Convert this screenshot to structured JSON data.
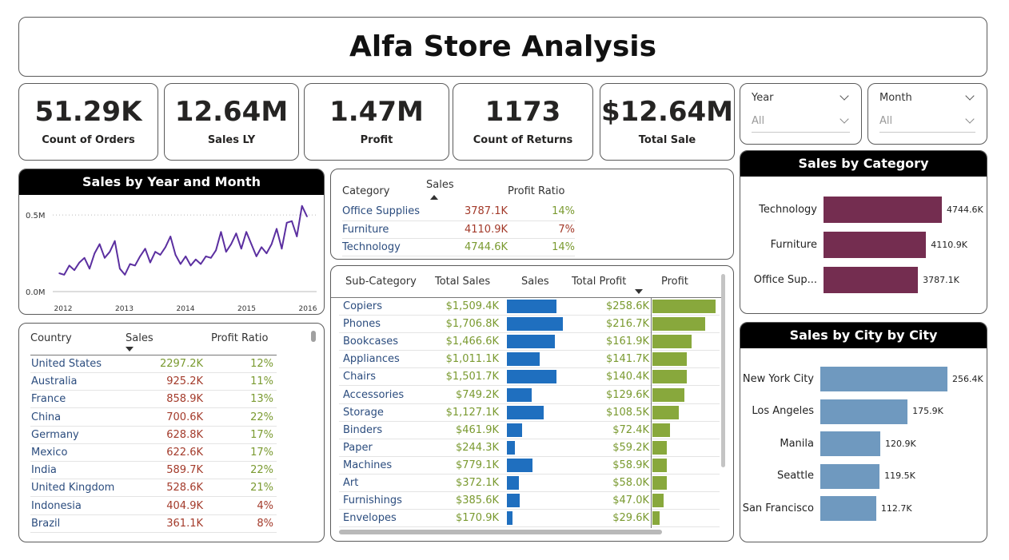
{
  "title": "Alfa Store Analysis",
  "kpis": [
    {
      "value": "51.29K",
      "label": "Count of Orders"
    },
    {
      "value": "12.64M",
      "label": "Sales LY"
    },
    {
      "value": "1.47M",
      "label": "Profit"
    },
    {
      "value": "1173",
      "label": "Count of Returns"
    },
    {
      "value": "$12.64M",
      "label": "Total Sale"
    }
  ],
  "slicers": {
    "year": {
      "label": "Year",
      "value": "All"
    },
    "month": {
      "label": "Month",
      "value": "All"
    }
  },
  "line_chart": {
    "title": "Sales by Year and Month",
    "y_ticks": [
      "0.5M",
      "0.0M"
    ],
    "x_ticks": [
      "2012",
      "2013",
      "2014",
      "2015",
      "2016"
    ],
    "color": "#5b2fa0"
  },
  "category_table": {
    "headers": [
      "Category",
      "Sales",
      "Profit Ratio"
    ],
    "rows": [
      {
        "name": "Office Supplies",
        "sales": "3787.1K",
        "ratio": "14%"
      },
      {
        "name": "Furniture",
        "sales": "4110.9K",
        "ratio": "7%"
      },
      {
        "name": "Technology",
        "sales": "4744.6K",
        "ratio": "14%"
      }
    ]
  },
  "subcat_table": {
    "headers": [
      "Sub-Category",
      "Total Sales",
      "Sales",
      "Total Profit",
      "Profit"
    ],
    "rows": [
      {
        "name": "Copiers",
        "total_sales": "$1,509.4K",
        "total_profit": "$258.6K"
      },
      {
        "name": "Phones",
        "total_sales": "$1,706.8K",
        "total_profit": "$216.7K"
      },
      {
        "name": "Bookcases",
        "total_sales": "$1,466.6K",
        "total_profit": "$161.9K"
      },
      {
        "name": "Appliances",
        "total_sales": "$1,011.1K",
        "total_profit": "$141.7K"
      },
      {
        "name": "Chairs",
        "total_sales": "$1,501.7K",
        "total_profit": "$140.4K"
      },
      {
        "name": "Accessories",
        "total_sales": "$749.2K",
        "total_profit": "$129.6K"
      },
      {
        "name": "Storage",
        "total_sales": "$1,127.1K",
        "total_profit": "$108.5K"
      },
      {
        "name": "Binders",
        "total_sales": "$461.9K",
        "total_profit": "$72.4K"
      },
      {
        "name": "Paper",
        "total_sales": "$244.3K",
        "total_profit": "$59.2K"
      },
      {
        "name": "Machines",
        "total_sales": "$779.1K",
        "total_profit": "$58.9K"
      },
      {
        "name": "Art",
        "total_sales": "$372.1K",
        "total_profit": "$58.0K"
      },
      {
        "name": "Furnishings",
        "total_sales": "$385.6K",
        "total_profit": "$47.0K"
      },
      {
        "name": "Envelopes",
        "total_sales": "$170.9K",
        "total_profit": "$29.6K"
      }
    ],
    "sales_bar_color": "#1f6fbf",
    "profit_bar_color": "#88a83c"
  },
  "country_table": {
    "headers": [
      "Country",
      "Sales",
      "Profit Ratio"
    ],
    "rows": [
      {
        "name": "United States",
        "sales": "2297.2K",
        "ratio": "12%"
      },
      {
        "name": "Australia",
        "sales": "925.2K",
        "ratio": "11%"
      },
      {
        "name": "France",
        "sales": "858.9K",
        "ratio": "13%"
      },
      {
        "name": "China",
        "sales": "700.6K",
        "ratio": "22%"
      },
      {
        "name": "Germany",
        "sales": "628.8K",
        "ratio": "17%"
      },
      {
        "name": "Mexico",
        "sales": "622.6K",
        "ratio": "17%"
      },
      {
        "name": "India",
        "sales": "589.7K",
        "ratio": "22%"
      },
      {
        "name": "United Kingdom",
        "sales": "528.6K",
        "ratio": "21%"
      },
      {
        "name": "Indonesia",
        "sales": "404.9K",
        "ratio": "4%"
      },
      {
        "name": "Brazil",
        "sales": "361.1K",
        "ratio": "8%"
      }
    ]
  },
  "category_chart": {
    "title": "Sales by Category",
    "color": "#742d50",
    "items": [
      {
        "label": "Technology",
        "value": 4744.6,
        "value_label": "4744.6K"
      },
      {
        "label": "Furniture",
        "value": 4110.9,
        "value_label": "4110.9K"
      },
      {
        "label": "Office Sup...",
        "value": 3787.1,
        "value_label": "3787.1K"
      }
    ]
  },
  "city_chart": {
    "title": "Sales by City by City",
    "color": "#6f99bf",
    "items": [
      {
        "label": "New York City",
        "value": 256.4,
        "value_label": "256.4K"
      },
      {
        "label": "Los Angeles",
        "value": 175.9,
        "value_label": "175.9K"
      },
      {
        "label": "Manila",
        "value": 120.9,
        "value_label": "120.9K"
      },
      {
        "label": "Seattle",
        "value": 119.5,
        "value_label": "119.5K"
      },
      {
        "label": "San Francisco",
        "value": 112.7,
        "value_label": "112.7K"
      }
    ]
  },
  "chart_data": [
    {
      "type": "line",
      "title": "Sales by Year and Month",
      "x_range": [
        "2012",
        "2016"
      ],
      "ylim": [
        0,
        0.6
      ],
      "y_unit": "M",
      "grid": true,
      "values": [
        0.12,
        0.11,
        0.17,
        0.14,
        0.19,
        0.22,
        0.15,
        0.25,
        0.31,
        0.22,
        0.26,
        0.33,
        0.15,
        0.11,
        0.18,
        0.17,
        0.23,
        0.28,
        0.19,
        0.26,
        0.24,
        0.29,
        0.36,
        0.24,
        0.18,
        0.23,
        0.17,
        0.21,
        0.18,
        0.23,
        0.22,
        0.27,
        0.39,
        0.26,
        0.31,
        0.38,
        0.28,
        0.39,
        0.31,
        0.23,
        0.29,
        0.25,
        0.31,
        0.41,
        0.28,
        0.45,
        0.46,
        0.36,
        0.56,
        0.49
      ]
    },
    {
      "type": "bar",
      "title": "Sales by Category",
      "categories": [
        "Technology",
        "Furniture",
        "Office Sup..."
      ],
      "values": [
        4744.6,
        4110.9,
        3787.1
      ]
    },
    {
      "type": "bar",
      "title": "Sales by City by City",
      "categories": [
        "New York City",
        "Los Angeles",
        "Manila",
        "Seattle",
        "San Francisco"
      ],
      "values": [
        256.4,
        175.9,
        120.9,
        119.5,
        112.7
      ]
    },
    {
      "type": "bar",
      "title": "",
      "categories": [
        "Copiers",
        "Phones",
        "Bookcases",
        "Appliances",
        "Chairs",
        "Accessories",
        "Storage",
        "Binders",
        "Paper",
        "Machines",
        "Art",
        "Furnishings",
        "Envelopes"
      ],
      "series": [
        {
          "name": "Sales",
          "values": [
            1509.4,
            1706.8,
            1466.6,
            1011.1,
            1501.7,
            749.2,
            1127.1,
            461.9,
            244.3,
            779.1,
            372.1,
            385.6,
            170.9
          ]
        },
        {
          "name": "Profit",
          "values": [
            258.6,
            216.7,
            161.9,
            141.7,
            140.4,
            129.6,
            108.5,
            72.4,
            59.2,
            58.9,
            58.0,
            47.0,
            29.6
          ]
        }
      ]
    }
  ]
}
